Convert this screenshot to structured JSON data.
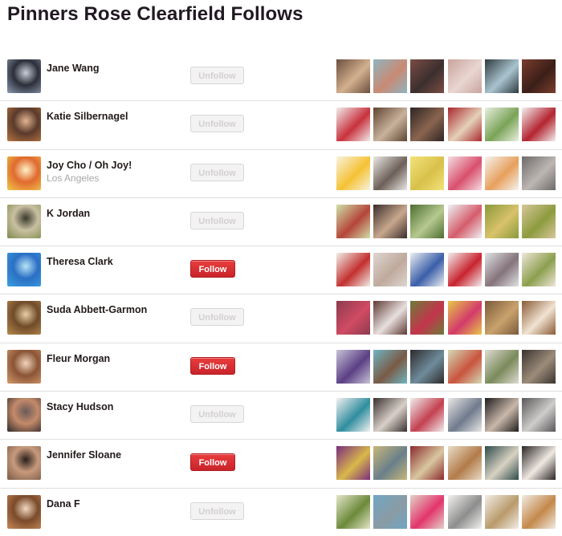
{
  "page": {
    "title": "Pinners Rose Clearfield Follows"
  },
  "users": [
    {
      "name": "Jane Wang",
      "location": "",
      "action": "Unfollow",
      "following": true,
      "avatar": [
        "#8d9ab0",
        "#2c2f3a",
        "#c7cfd9"
      ],
      "pins": [
        [
          "#6b4f3e",
          "#d3b08e"
        ],
        [
          "#8fb4bf",
          "#c98a74"
        ],
        [
          "#7a4d44",
          "#3c2f2e"
        ],
        [
          "#c9a39d",
          "#e9d6d2"
        ],
        [
          "#2f3a3f",
          "#a9c4d0"
        ],
        [
          "#7a3c2e",
          "#3b1f18"
        ]
      ]
    },
    {
      "name": "Katie Silbernagel",
      "location": "",
      "action": "Unfollow",
      "following": true,
      "avatar": [
        "#b8763f",
        "#5a3a2c",
        "#e2b58e"
      ],
      "pins": [
        [
          "#f1ecec",
          "#c8313c"
        ],
        [
          "#5e4532",
          "#c9b29c"
        ],
        [
          "#2f2523",
          "#8a6550"
        ],
        [
          "#a9282c",
          "#e5d1b9"
        ],
        [
          "#e9efe0",
          "#7aa357"
        ],
        [
          "#f2f0f0",
          "#b42430"
        ]
      ]
    },
    {
      "name": "Joy Cho / Oh Joy!",
      "location": "Los Angeles",
      "action": "Unfollow",
      "following": true,
      "avatar": [
        "#f1c84b",
        "#e06a2f",
        "#fff1c4"
      ],
      "pins": [
        [
          "#f8f3df",
          "#f5c234"
        ],
        [
          "#ece9e6",
          "#6c5f57"
        ],
        [
          "#f3e27c",
          "#d8c14a"
        ],
        [
          "#f4dde3",
          "#d94f6c"
        ],
        [
          "#f5f3f1",
          "#e7a05c"
        ],
        [
          "#6d6a69",
          "#bdb7b3"
        ]
      ]
    },
    {
      "name": "K Jordan",
      "location": "",
      "action": "Unfollow",
      "following": true,
      "avatar": [
        "#7e8a4c",
        "#c9c0a2",
        "#3a3a2a"
      ],
      "pins": [
        [
          "#cfe0a8",
          "#b5453a"
        ],
        [
          "#3a2d2a",
          "#c8a78e"
        ],
        [
          "#4d6e32",
          "#b6c98f"
        ],
        [
          "#eef2f3",
          "#d55c6c"
        ],
        [
          "#8a9a3a",
          "#d9c26b"
        ],
        [
          "#d7c79b",
          "#8d9b3e"
        ]
      ]
    },
    {
      "name": "Theresa Clark",
      "location": "",
      "action": "Follow",
      "following": false,
      "avatar": [
        "#3aa0e0",
        "#2a6fc4",
        "#b8e4f7"
      ],
      "pins": [
        [
          "#f1efe9",
          "#c3302f"
        ],
        [
          "#ded6d2",
          "#bfa99c"
        ],
        [
          "#eceff2",
          "#3a5ea8"
        ],
        [
          "#f3efef",
          "#c8242e"
        ],
        [
          "#dfe3e4",
          "#85737a"
        ],
        [
          "#efe6d9",
          "#8c9f4e"
        ]
      ]
    },
    {
      "name": "Suda Abbett-Garmon",
      "location": "",
      "action": "Unfollow",
      "following": true,
      "avatar": [
        "#b98a4e",
        "#6f4b2a",
        "#e8cfa4"
      ],
      "pins": [
        [
          "#8d3b4f",
          "#d04b63"
        ],
        [
          "#5e3a34",
          "#e8e0de"
        ],
        [
          "#6d7c3a",
          "#c4344c"
        ],
        [
          "#e8c74a",
          "#d23a6a"
        ],
        [
          "#7b5a3a",
          "#c9a26c"
        ],
        [
          "#8a5b36",
          "#f1e3d2"
        ]
      ]
    },
    {
      "name": "Fleur Morgan",
      "location": "",
      "action": "Follow",
      "following": false,
      "avatar": [
        "#d49b6c",
        "#8a5436",
        "#f0d4bb"
      ],
      "pins": [
        [
          "#c8c3d6",
          "#5b3f84"
        ],
        [
          "#6fb6c2",
          "#7a5a45"
        ],
        [
          "#2d2a2b",
          "#6f8c9b"
        ],
        [
          "#d4d9b6",
          "#c9543e"
        ],
        [
          "#dedbd2",
          "#7a8a5a"
        ],
        [
          "#3a342f",
          "#9c8c7a"
        ]
      ]
    },
    {
      "name": "Stacy Hudson",
      "location": "",
      "action": "Unfollow",
      "following": true,
      "avatar": [
        "#2e2a2a",
        "#c48a6a",
        "#6a5a58"
      ],
      "pins": [
        [
          "#f3f2f1",
          "#2f8d9e"
        ],
        [
          "#3a3030",
          "#d8d0c8"
        ],
        [
          "#f0eeee",
          "#c44050"
        ],
        [
          "#e9e8e6",
          "#6f7a8c"
        ],
        [
          "#1f1d1d",
          "#c9b8aa"
        ],
        [
          "#595757",
          "#cfcccc"
        ]
      ]
    },
    {
      "name": "Jennifer Sloane",
      "location": "",
      "action": "Follow",
      "following": false,
      "avatar": [
        "#7a5a46",
        "#c79a7c",
        "#2a1f1a"
      ],
      "pins": [
        [
          "#7a2c7e",
          "#d9b84a"
        ],
        [
          "#c7b77a",
          "#6a7f8a"
        ],
        [
          "#8a2a2c",
          "#d9c7a0"
        ],
        [
          "#e8dcc6",
          "#b27b4a"
        ],
        [
          "#2d4a4a",
          "#d8d2c2"
        ],
        [
          "#2a2525",
          "#efe9e2"
        ]
      ]
    },
    {
      "name": "Dana F",
      "location": "",
      "action": "Unfollow",
      "following": true,
      "avatar": [
        "#c98a5a",
        "#7a4a2a",
        "#f2d9c2"
      ],
      "pins": [
        [
          "#e4e6c9",
          "#6c8a3a"
        ],
        [
          "#6fa6c4",
          "#8a9ba4"
        ],
        [
          "#e2d2c8",
          "#e3356c"
        ],
        [
          "#f3f2ef",
          "#8d8d8d"
        ],
        [
          "#f2eee8",
          "#b99a6b"
        ],
        [
          "#f1ece3",
          "#c4884a"
        ]
      ]
    }
  ]
}
